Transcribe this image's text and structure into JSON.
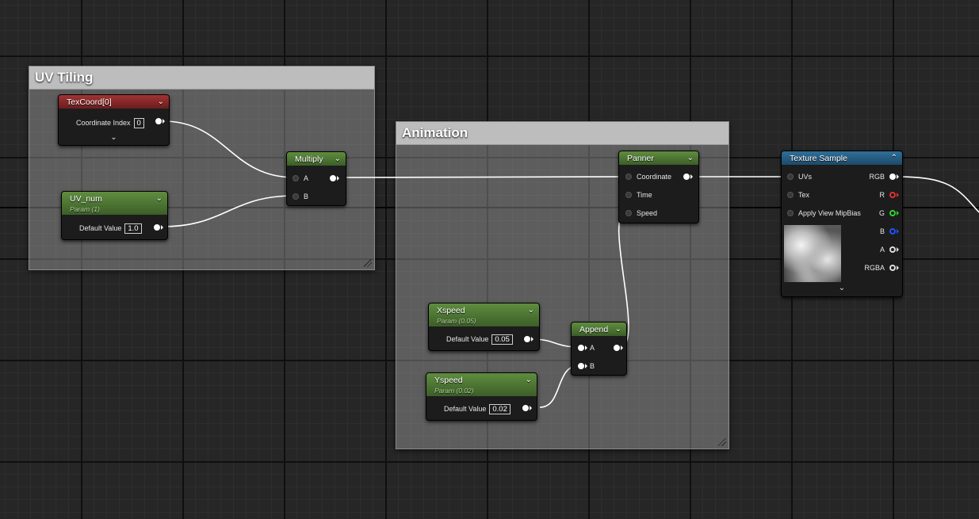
{
  "comments": {
    "uv_tiling": "UV Tiling",
    "animation": "Animation"
  },
  "nodes": {
    "texcoord": {
      "title": "TexCoord[0]",
      "label": "Coordinate Index",
      "value": "0"
    },
    "uv_num": {
      "title": "UV_num",
      "subtitle": "Param (1)",
      "label": "Default Value",
      "value": "1.0"
    },
    "multiply": {
      "title": "Multiply",
      "in_a": "A",
      "in_b": "B"
    },
    "panner": {
      "title": "Panner",
      "coordinate": "Coordinate",
      "time": "Time",
      "speed": "Speed"
    },
    "xspeed": {
      "title": "Xspeed",
      "subtitle": "Param (0.05)",
      "label": "Default Value",
      "value": "0.05"
    },
    "yspeed": {
      "title": "Yspeed",
      "subtitle": "Param (0.02)",
      "label": "Default Value",
      "value": "0.02"
    },
    "append": {
      "title": "Append",
      "in_a": "A",
      "in_b": "B"
    },
    "texture_sample": {
      "title": "Texture Sample",
      "inputs": [
        "UVs",
        "Tex",
        "Apply View MipBias"
      ],
      "outputs": [
        "RGB",
        "R",
        "G",
        "B",
        "A",
        "RGBA"
      ]
    }
  },
  "colors": {
    "pin_r": "#e03030",
    "pin_g": "#30d030",
    "pin_b": "#2050ff",
    "wire": "#ffffff"
  }
}
